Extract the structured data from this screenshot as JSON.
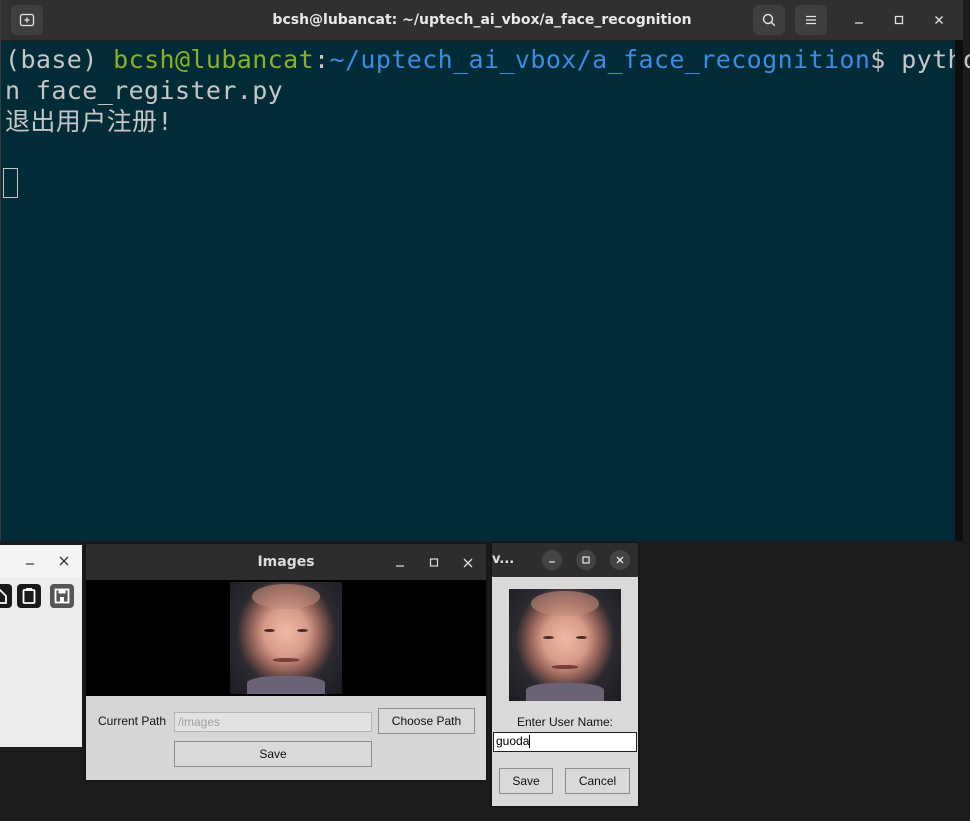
{
  "terminal": {
    "title": "bcsh@lubancat: ~/uptech_ai_vbox/a_face_recognition",
    "prompt_env": "(base) ",
    "prompt_user": "bcsh@lubancat",
    "prompt_colon": ":",
    "prompt_path": "~/uptech_ai_vbox/a_face_recognition",
    "prompt_dollar": "$ ",
    "command_line1": "pytho",
    "command_line2": "n face_register.py",
    "output_line": "退出用户注册!",
    "icons": [
      "new-tab-icon",
      "search-icon",
      "menu-icon",
      "minimize-icon",
      "maximize-icon",
      "close-icon"
    ]
  },
  "images_window": {
    "title": "Images",
    "current_path_label": "Current Path",
    "path_placeholder": "/images",
    "choose_path_label": "Choose Path",
    "save_label": "Save"
  },
  "register_dialog": {
    "title": "v...",
    "prompt_label": "Enter User Name:",
    "user_name_value": "guoda",
    "save_label": "Save",
    "cancel_label": "Cancel"
  },
  "left_window": {
    "icons": [
      "home-icon",
      "clipboard-icon",
      "save-icon"
    ]
  },
  "colors": {
    "terminal_bg": "#012b36",
    "prompt_user": "#8ab125",
    "prompt_path": "#3a8ce0",
    "terminal_text": "#c6c6c6"
  }
}
